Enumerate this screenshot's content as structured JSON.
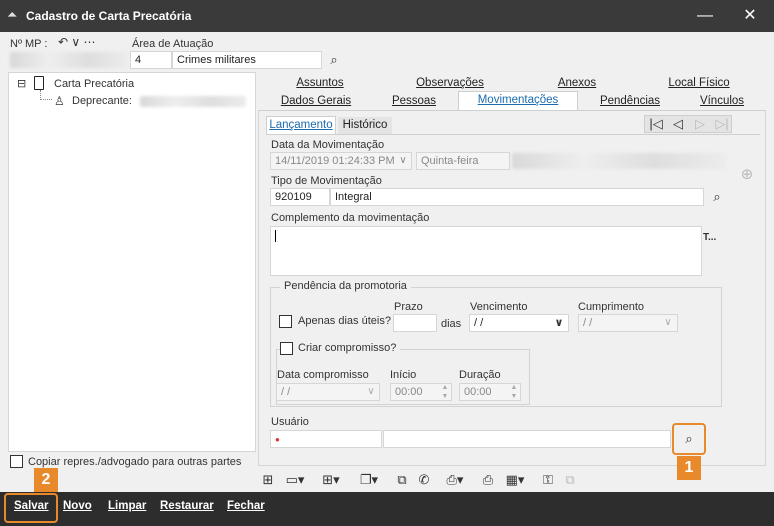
{
  "window": {
    "title": "Cadastro de Carta Precatória",
    "minimize": "—",
    "maximize": "☐",
    "close": "✕"
  },
  "header": {
    "mp_label": "Nº MP :",
    "mp_arrows": "↶ ∨ ⋯",
    "area_label": "Área de Atuação",
    "area_code": "4",
    "area_name": "Crimes militares"
  },
  "tree": {
    "root_label": "Carta Precatória",
    "child_label": "Deprecante:",
    "expander": "⊟"
  },
  "tabs_row1": [
    "Assuntos",
    "Observações",
    "Anexos",
    "Local Físico"
  ],
  "tabs_row2": [
    "Dados Gerais",
    "Pessoas",
    "Movimentações",
    "Pendências",
    "Vínculos"
  ],
  "subtabs": [
    "Lançamento",
    "Histórico"
  ],
  "nav": [
    "|◁",
    "◁",
    "▷",
    "▷|"
  ],
  "movimentacao": {
    "data_label": "Data da Movimentação",
    "data_value": "14/11/2019 01:24:33 PM",
    "weekday": "Quinta-feira",
    "tipo_label": "Tipo de Movimentação",
    "tipo_code": "920109",
    "tipo_name": "Integral",
    "complemento_label": "Complemento da movimentação",
    "complemento_side": "T..."
  },
  "pendencia": {
    "group_title": "Pendência da promotoria",
    "apenas_label": "Apenas dias úteis?",
    "prazo_label": "Prazo",
    "dias_label": "dias",
    "vencimento_label": "Vencimento",
    "vencimento_value": " /  /",
    "cumprimento_label": "Cumprimento",
    "cumprimento_value": " /  /",
    "criar_label": "Criar compromisso?",
    "data_comp_label": "Data compromisso",
    "data_comp_value": " /  /",
    "inicio_label": "Início",
    "inicio_value": "00:00",
    "duracao_label": "Duração",
    "duracao_value": "00:00"
  },
  "usuario": {
    "label": "Usuário",
    "required_dot": "●"
  },
  "copiar_label": "Copiar repres./advogado para outras partes",
  "toolbar_icons": [
    "add-record-icon",
    "calendar-window-icon",
    "tree-icon",
    "copy-icon",
    "documents-icon",
    "phone-icon",
    "printer-icon",
    "print-icon",
    "calendar-icon",
    "lock-icon",
    "network-icon"
  ],
  "buttons": {
    "salvar": "Salvar",
    "novo": "Novo",
    "limpar": "Limpar",
    "restaurar": "Restaurar",
    "fechar": "Fechar"
  },
  "annotations": {
    "badge1": "1",
    "badge2": "2"
  },
  "colors": {
    "accent": "#e8892c",
    "titlebar": "#3a3a3a",
    "active_tab": "#1a6bb0",
    "required": "#e03030"
  }
}
